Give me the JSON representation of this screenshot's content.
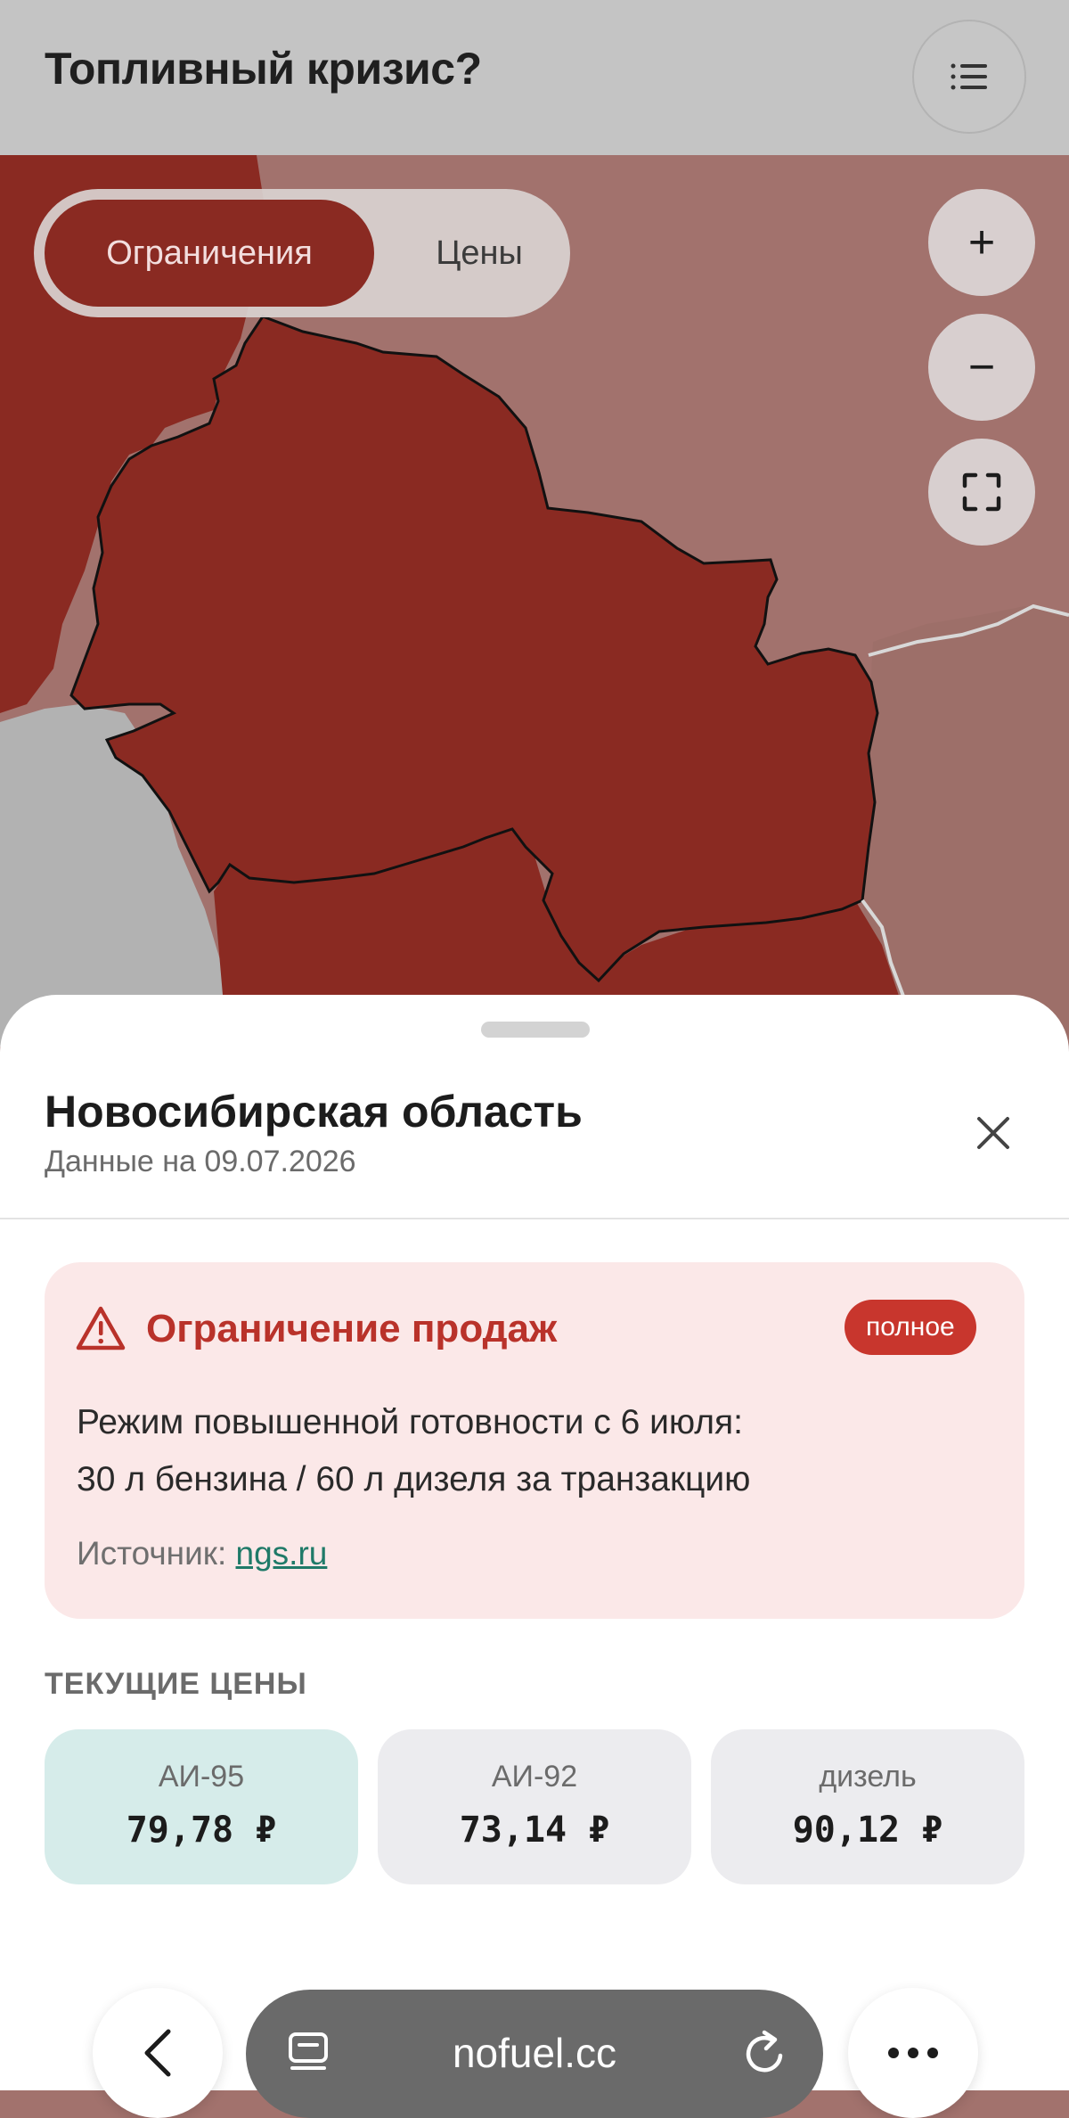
{
  "header": {
    "title": "Топливный кризис?",
    "menu_icon": "list-icon"
  },
  "map": {
    "toggle": {
      "active": "Ограничения",
      "inactive": "Цены"
    },
    "controls": {
      "zoom_in": "+",
      "zoom_out": "−",
      "fullscreen_icon": "expand-icon"
    },
    "colors": {
      "selected_region": "#8a2a22",
      "restricted": "#8a2a22",
      "neighbor": "#a2726d",
      "no_data": "#b2b2b2"
    }
  },
  "sheet": {
    "region_name": "Новосибирская область",
    "data_date": "Данные на 09.07.2026",
    "close_icon": "close-icon",
    "alert": {
      "icon": "warning-icon",
      "title": "Ограничение продаж",
      "badge": "полное",
      "text_line1": "Режим повышенной готовности с 6 июля:",
      "text_line2": "30 л бензина / 60 л дизеля за транзакцию",
      "source_label": "Источник: ",
      "source_link": "ngs.ru"
    },
    "prices_heading": "ТЕКУЩИЕ ЦЕНЫ",
    "prices": [
      {
        "label": "АИ-95",
        "value": "79,78 ₽"
      },
      {
        "label": "АИ-92",
        "value": "73,14 ₽"
      },
      {
        "label": "дизель",
        "value": "90,12 ₽"
      }
    ]
  },
  "browser": {
    "url": "nofuel.cc",
    "back_icon": "chevron-left-icon",
    "tabs_icon": "tabs-icon",
    "reload_icon": "reload-icon",
    "more_icon": "more-icon"
  }
}
